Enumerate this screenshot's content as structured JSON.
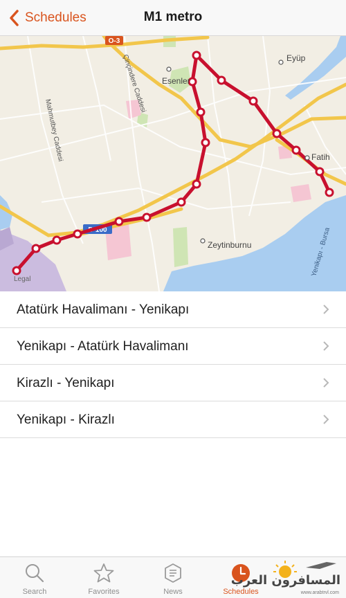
{
  "navbar": {
    "back_label": "Schedules",
    "title": "M1 metro"
  },
  "map": {
    "labels": {
      "road_o3": "O-3",
      "eyup": "Eyüp",
      "esenler": "Esenler",
      "cincindere": "Çinçindere Caddesi",
      "mahmutbey": "Mahmutbey Caddesi",
      "fatih": "Fatih",
      "zeytinburnu": "Zeytinburnu",
      "road_d100": "D-100",
      "yenikapi_bursa": "Yenikapı - Bursa",
      "legal": "Legal"
    },
    "route_color": "#c8102e"
  },
  "routes": [
    {
      "label": "Atatürk Havalimanı - Yenikapı"
    },
    {
      "label": "Yenikapı - Atatürk Havalimanı"
    },
    {
      "label": "Kirazlı - Yenikapı"
    },
    {
      "label": "Yenikapı - Kirazlı"
    }
  ],
  "tabs": [
    {
      "label": "Search",
      "icon": "search-icon"
    },
    {
      "label": "Favorites",
      "icon": "star-icon"
    },
    {
      "label": "News",
      "icon": "news-icon"
    },
    {
      "label": "Schedules",
      "icon": "clock-icon",
      "active": true
    }
  ],
  "watermark": {
    "text": "المسافرون العرب",
    "url": "www.arabtrvl.com"
  },
  "colors": {
    "accent": "#d9541e",
    "road": "#f2c64b",
    "water": "#a9cdf0"
  }
}
